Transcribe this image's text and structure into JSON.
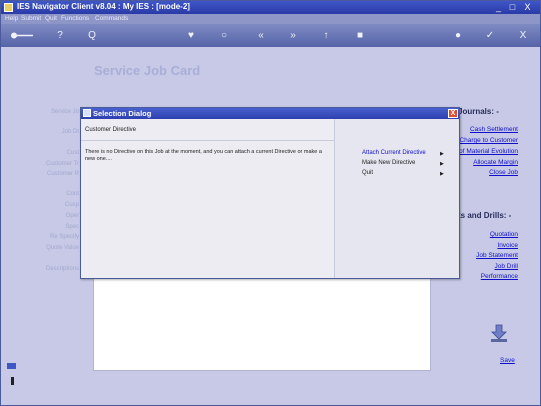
{
  "window": {
    "title": "IES Navigator Client v8.04 : My IES :     [mode-2]",
    "minimize": "_",
    "maximize": "□",
    "close": "X"
  },
  "menu": [
    "Help",
    "Submit",
    "Quit",
    "Functions",
    "Commands"
  ],
  "toolbar": {
    "labels": [
      "●",
      "?",
      "Q",
      "♥",
      "○",
      "«",
      "»",
      "↑",
      "■",
      "●",
      "✓",
      "X"
    ]
  },
  "page": {
    "title": "Service Job Card",
    "ghost_labels": [
      "Service Jo",
      "Job Dt",
      "Cust",
      "Customer Tr",
      "Customer R",
      "Cont",
      "Cusp",
      "Oper",
      "Spec",
      "Re Specify",
      "Quote Value",
      "Descriptions"
    ]
  },
  "right_panel": {
    "journals_heading": "Journals: -",
    "journal_links": [
      "Cash Settlement",
      "Charge to Customer",
      "of Material Evolution",
      "Allocate Margin",
      "Close Job"
    ],
    "drills_heading": "ts and Drills: -",
    "drill_links": [
      "Quotation",
      "Invoice",
      "Job Statement",
      "Job Drill",
      "Performance"
    ],
    "save_label": "Save"
  },
  "dialog": {
    "title": "Selection Dialog",
    "close": "X",
    "header": "Customer Directive",
    "message": "There is no Directive on this Job at the moment, and you can attach a current Directive or make a new one....",
    "options": [
      {
        "label": "Attach Current Directive",
        "active": true
      },
      {
        "label": "Make New Directive",
        "active": false
      },
      {
        "label": "Quit",
        "active": false
      }
    ],
    "arrow": "▶"
  }
}
